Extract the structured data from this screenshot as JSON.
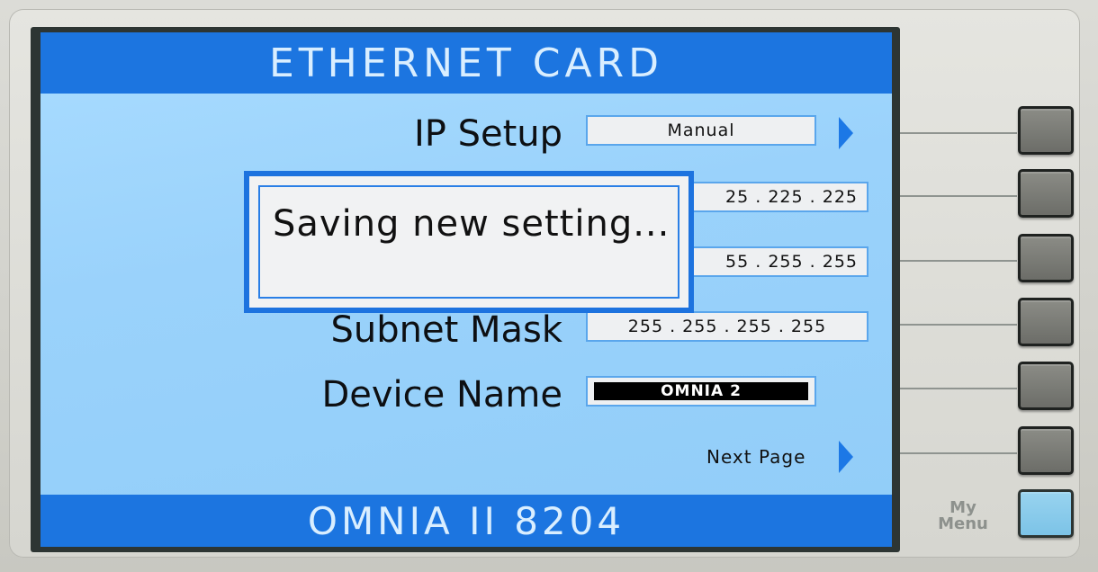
{
  "screen": {
    "title": "ETHERNET CARD",
    "footer": "OMNIA II   8204"
  },
  "rows": {
    "ip_setup": {
      "label": "IP Setup",
      "value": "Manual"
    },
    "ip_address": {
      "value": "25 . 225 . 225"
    },
    "gateway": {
      "value": "55 . 255 . 255"
    },
    "subnet_mask": {
      "label": "Subnet Mask",
      "value": "255 . 255 . 255 . 255"
    },
    "device_name": {
      "label": "Device Name",
      "value": "OMNIA 2"
    },
    "next_page": {
      "label": "Next Page"
    }
  },
  "dialog": {
    "message": "Saving new setting..."
  },
  "hardware": {
    "my_menu_label": "My\nMenu"
  },
  "colors": {
    "accent_blue": "#1c75e0",
    "screen_bg": "#9ad2fb",
    "field_bg": "#eef0f2",
    "my_menu_button": "#7cc3e7"
  }
}
